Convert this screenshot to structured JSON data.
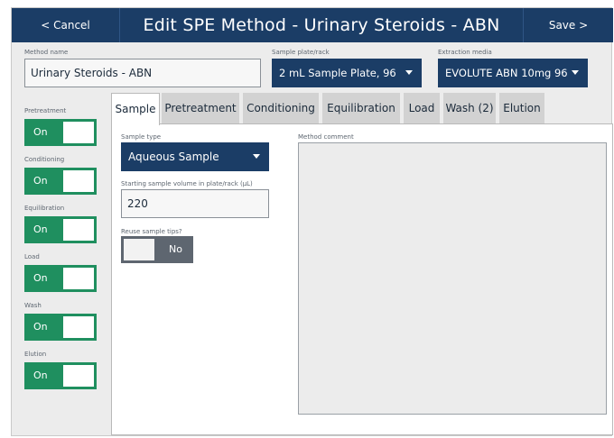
{
  "header": {
    "cancel_label": "< Cancel",
    "title": "Edit SPE Method - Urinary Steroids - ABN",
    "save_label": "Save >"
  },
  "method_name": {
    "label": "Method name",
    "value": "Urinary Steroids - ABN"
  },
  "sample_plate": {
    "label": "Sample plate/rack",
    "value": "2 mL Sample Plate, 96"
  },
  "extraction_media": {
    "label": "Extraction media",
    "value": "EVOLUTE ABN 10mg 96"
  },
  "steps": [
    {
      "label": "Pretreatment",
      "state": "On"
    },
    {
      "label": "Conditioning",
      "state": "On"
    },
    {
      "label": "Equilibration",
      "state": "On"
    },
    {
      "label": "Load",
      "state": "On"
    },
    {
      "label": "Wash",
      "state": "On"
    },
    {
      "label": "Elution",
      "state": "On"
    }
  ],
  "tabs": [
    {
      "label": "Sample",
      "active": true
    },
    {
      "label": "Pretreatment"
    },
    {
      "label": "Conditioning"
    },
    {
      "label": "Equilibration"
    },
    {
      "label": "Load"
    },
    {
      "label": "Wash (2)"
    },
    {
      "label": "Elution"
    }
  ],
  "sample_tab": {
    "sample_type": {
      "label": "Sample type",
      "value": "Aqueous Sample"
    },
    "starting_volume": {
      "label": "Starting sample volume in plate/rack (μL)",
      "value": "220"
    },
    "reuse_tips": {
      "label": "Reuse sample tips?",
      "state": "No"
    },
    "method_comment": {
      "label": "Method comment",
      "value": ""
    }
  },
  "colors": {
    "navy": "#1b3d66",
    "toggle_on": "#1f8f5f",
    "toggle_off": "#5e6670"
  }
}
